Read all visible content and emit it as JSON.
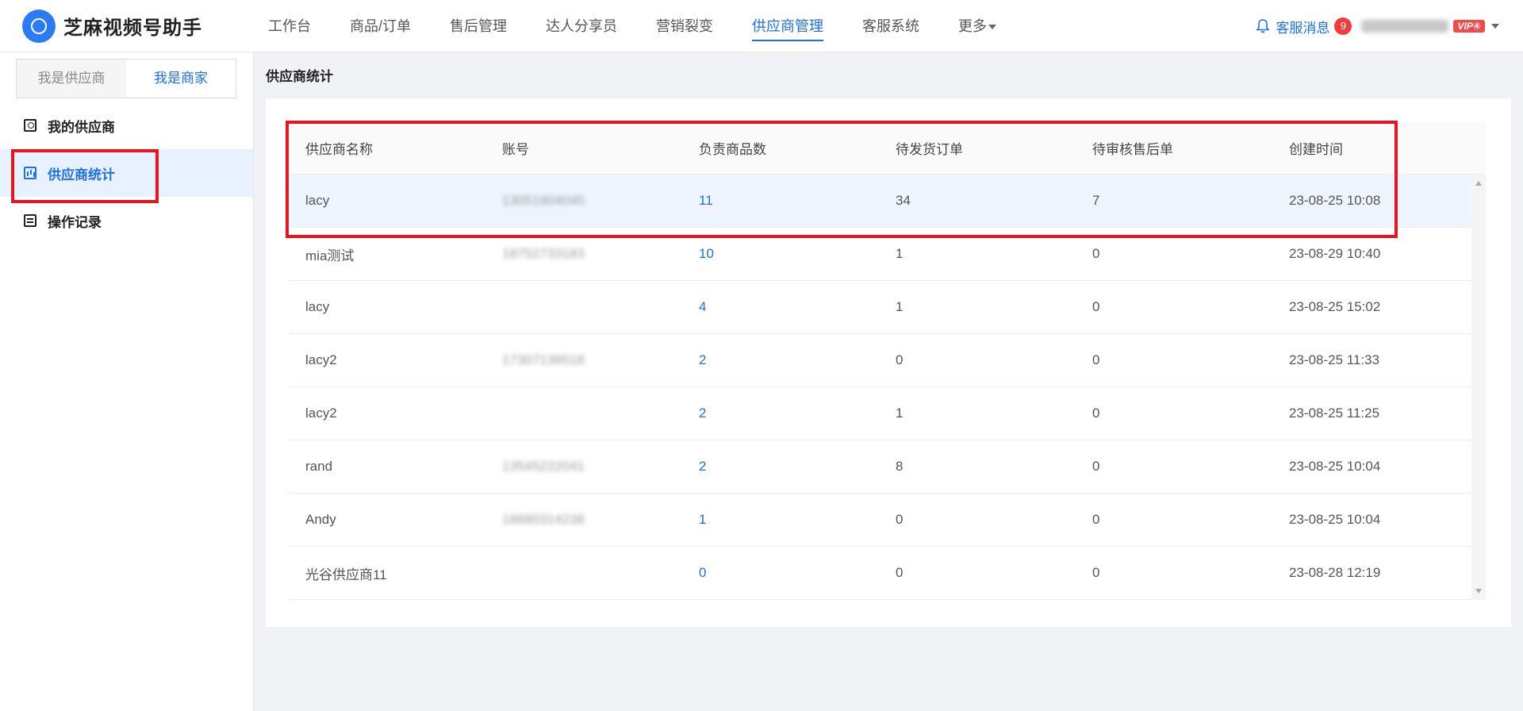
{
  "header": {
    "app_name": "芝麻视频号助手",
    "nav": [
      {
        "label": "工作台",
        "active": false
      },
      {
        "label": "商品/订单",
        "active": false
      },
      {
        "label": "售后管理",
        "active": false
      },
      {
        "label": "达人分享员",
        "active": false
      },
      {
        "label": "营销裂变",
        "active": false
      },
      {
        "label": "供应商管理",
        "active": true
      },
      {
        "label": "客服系统",
        "active": false
      },
      {
        "label": "更多",
        "active": false
      }
    ],
    "messages_label": "客服消息",
    "messages_count": "9",
    "vip_label": "VIP④",
    "accent_color": "#1f6fe5"
  },
  "sidebar": {
    "role_tabs": [
      {
        "label": "我是供应商",
        "active": false
      },
      {
        "label": "我是商家",
        "active": true
      }
    ],
    "items": [
      {
        "label": "我的供应商",
        "icon": "person-card-icon",
        "active": false
      },
      {
        "label": "供应商统计",
        "icon": "bar-chart-icon",
        "active": true
      },
      {
        "label": "操作记录",
        "icon": "log-icon",
        "active": false
      }
    ]
  },
  "main": {
    "title": "供应商统计",
    "table": {
      "columns": [
        "供应商名称",
        "账号",
        "负责商品数",
        "待发货订单",
        "待审核售后单",
        "创建时间"
      ],
      "rows": [
        {
          "name": "lacy",
          "account": "13051904045",
          "products": "11",
          "pending_ship": "34",
          "pending_after_sale": "7",
          "created": "23-08-25 10:08"
        },
        {
          "name": "mia测试",
          "account": "18752733183",
          "products": "10",
          "pending_ship": "1",
          "pending_after_sale": "0",
          "created": "23-08-29 10:40"
        },
        {
          "name": "lacy",
          "account": "",
          "products": "4",
          "pending_ship": "1",
          "pending_after_sale": "0",
          "created": "23-08-25 15:02"
        },
        {
          "name": "lacy2",
          "account": "17307138518",
          "products": "2",
          "pending_ship": "0",
          "pending_after_sale": "0",
          "created": "23-08-25 11:33"
        },
        {
          "name": "lacy2",
          "account": "",
          "products": "2",
          "pending_ship": "1",
          "pending_after_sale": "0",
          "created": "23-08-25 11:25"
        },
        {
          "name": "rand",
          "account": "13545222041",
          "products": "2",
          "pending_ship": "8",
          "pending_after_sale": "0",
          "created": "23-08-25 10:04"
        },
        {
          "name": "Andy",
          "account": "18680314238",
          "products": "1",
          "pending_ship": "0",
          "pending_after_sale": "0",
          "created": "23-08-25 10:04"
        },
        {
          "name": "光谷供应商11",
          "account": "",
          "products": "0",
          "pending_ship": "0",
          "pending_after_sale": "0",
          "created": "23-08-28 12:19"
        }
      ]
    }
  }
}
